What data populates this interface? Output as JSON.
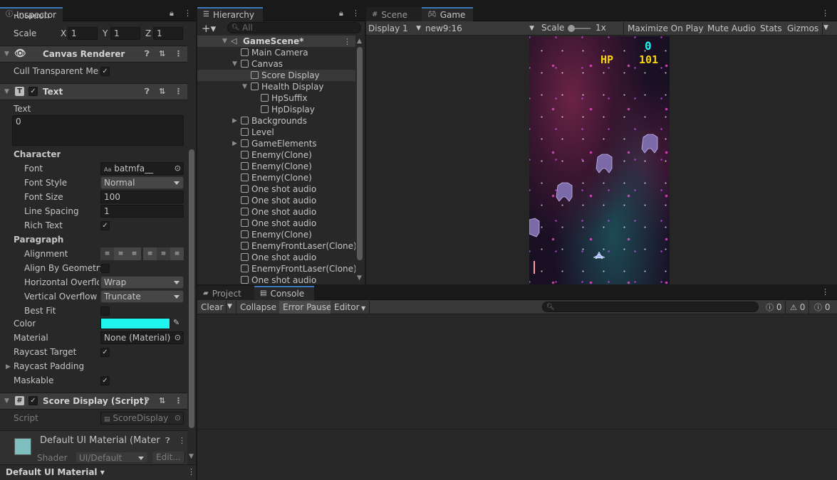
{
  "inspector": {
    "tab": "Inspector",
    "rotation_label": "Rotation",
    "scale_label": "Scale",
    "scale": {
      "x": "1",
      "y": "1",
      "z": "1"
    },
    "axis": {
      "x": "X",
      "y": "Y",
      "z": "Z"
    },
    "canvas_renderer": {
      "title": "Canvas Renderer",
      "cull_label": "Cull Transparent Mes"
    },
    "text_comp": {
      "title": "Text",
      "text_label": "Text",
      "text_value": "0",
      "character": "Character",
      "font_label": "Font",
      "font_value": "batmfa__",
      "font_style_label": "Font Style",
      "font_style_value": "Normal",
      "font_size_label": "Font Size",
      "font_size_value": "100",
      "line_spacing_label": "Line Spacing",
      "line_spacing_value": "1",
      "rich_text_label": "Rich Text",
      "paragraph": "Paragraph",
      "alignment_label": "Alignment",
      "align_geom_label": "Align By Geometry",
      "h_overflow_label": "Horizontal Overflow",
      "h_overflow_value": "Wrap",
      "v_overflow_label": "Vertical Overflow",
      "v_overflow_value": "Truncate",
      "best_fit_label": "Best Fit",
      "color_label": "Color",
      "color_value": "#1ff5ee",
      "material_label": "Material",
      "material_value": "None (Material)",
      "raycast_label": "Raycast Target",
      "raycast_padding_label": "Raycast Padding",
      "maskable_label": "Maskable"
    },
    "score_script": {
      "title": "Score Display (Script)",
      "script_label": "Script",
      "script_value": "ScoreDisplay"
    },
    "material_preview": {
      "title": "Default UI Material (Materia",
      "shader_label": "Shader",
      "shader_value": "UI/Default",
      "edit_label": "Edit..."
    },
    "footer": "Default UI Material"
  },
  "hierarchy": {
    "tab": "Hierarchy",
    "search_placeholder": "All",
    "scene": "GameScene*",
    "items": [
      "Main Camera",
      "Canvas",
      "Score Display",
      "Health Display",
      "HpSuffix",
      "HpDisplay",
      "Backgrounds",
      "Level",
      "GameElements",
      "Enemy(Clone)",
      "Enemy(Clone)",
      "Enemy(Clone)",
      "One shot audio",
      "One shot audio",
      "One shot audio",
      "One shot audio",
      "Enemy(Clone)",
      "EnemyFrontLaser(Clone)",
      "One shot audio",
      "EnemyFrontLaser(Clone)",
      "One shot audio"
    ]
  },
  "game_view": {
    "tab_scene": "Scene",
    "tab_game": "Game",
    "display": "Display 1",
    "resolution": "new9:16",
    "scale_label": "Scale",
    "scale_value": "1x",
    "maximize": "Maximize On Play",
    "mute": "Mute Audio",
    "stats": "Stats",
    "gizmos": "Gizmos",
    "hud_score": "0",
    "hud_hp_label": "HP",
    "hud_hp_value": "101"
  },
  "console": {
    "tab_project": "Project",
    "tab_console": "Console",
    "clear": "Clear",
    "collapse": "Collapse",
    "error_pause": "Error Pause",
    "editor": "Editor",
    "log_count": "0",
    "warn_count": "0",
    "error_count": "0"
  },
  "colors": {
    "accent": "#3a79bb",
    "selection": "#2c5d87",
    "hud_yellow": "#f5d60d",
    "hud_cyan": "#1ff5ee"
  }
}
